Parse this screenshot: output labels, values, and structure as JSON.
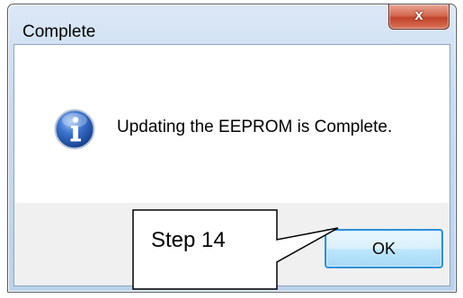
{
  "dialog": {
    "title": "Complete",
    "message": "Updating the EEPROM is Complete.",
    "ok_label": "OK",
    "close_icon": "x",
    "message_icon": "info-icon"
  },
  "callout": {
    "text": "Step 14"
  },
  "colors": {
    "info_icon": "#1f56b0",
    "ok_border": "#2f8fd8",
    "close_button": "#c2432b"
  }
}
